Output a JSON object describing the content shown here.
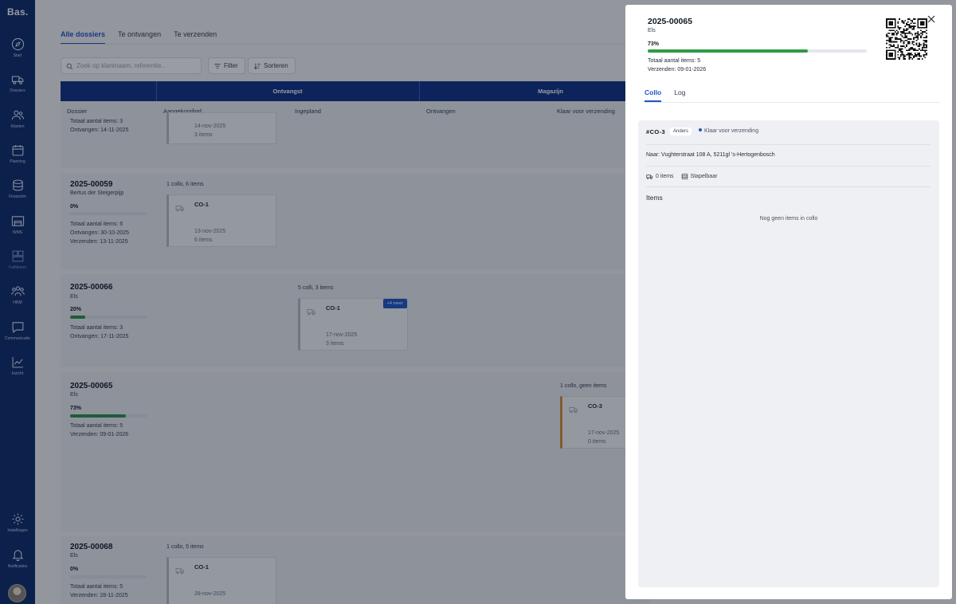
{
  "app": {
    "logo": "Bas."
  },
  "sidebar": {
    "items": [
      {
        "label": "Start",
        "icon": "compass-icon"
      },
      {
        "label": "Dossiers",
        "icon": "truck-icon"
      },
      {
        "label": "Klanten",
        "icon": "users-icon"
      },
      {
        "label": "Planning",
        "icon": "calendar-icon"
      },
      {
        "label": "Financiën",
        "icon": "coins-icon"
      },
      {
        "label": "WMS",
        "icon": "warehouse-icon"
      },
      {
        "label": "Fulfilment",
        "icon": "boxes-icon"
      },
      {
        "label": "HRM",
        "icon": "team-icon"
      },
      {
        "label": "Communicatie",
        "icon": "chat-icon"
      },
      {
        "label": "Inzicht",
        "icon": "chart-icon"
      }
    ],
    "bottom": [
      {
        "label": "Instellingen",
        "icon": "gear-icon"
      },
      {
        "label": "Notificaties",
        "icon": "bell-icon"
      }
    ]
  },
  "main": {
    "tabs": [
      "Alle dossiers",
      "Te ontvangen",
      "Te verzenden"
    ],
    "search_placeholder": "Zoek op klantnaam, referentie...",
    "filter_label": "Filter",
    "sort_label": "Sorteren",
    "groups": [
      "Ontvangst",
      "Magazijn"
    ],
    "columns": [
      "Dossier",
      "Aangekondigd",
      "Ingepland",
      "Ontvangen",
      "Klaar voor verzending"
    ],
    "rows": [
      {
        "partial": true,
        "lines": [
          "Totaal aantal items: 3",
          "Ontvangen: 14-11-2025"
        ],
        "card_date": "14-nov-2025",
        "card_count": "3 items"
      },
      {
        "title": "2025-00059",
        "sub": "Bertus der Steigerpijp",
        "pct": "0%",
        "progress": 0,
        "lines": [
          "Totaal aantal items: 6",
          "Ontvangen: 30-10-2025",
          "Verzenden: 13-11-2025"
        ],
        "lane": "1 collo, 6 items",
        "card": {
          "name": "CO-1",
          "date": "13-nov-2025",
          "count": "6 items"
        }
      },
      {
        "title": "2025-00066",
        "sub": "Els",
        "pct": "20%",
        "progress": 0.2,
        "lines": [
          "Totaal aantal items: 3",
          "Ontvangen: 17-11-2025"
        ],
        "lane": "5 colli, 3 items",
        "card": {
          "name": "CO-1",
          "date": "17-nov-2025",
          "count": "3 items",
          "more": "+4 meer"
        }
      },
      {
        "title": "2025-00065",
        "sub": "Els",
        "pct": "73%",
        "progress": 0.73,
        "lines": [
          "Totaal aantal items: 5",
          "Verzenden: 09-01-2026"
        ],
        "lane": "1 collo, geen items",
        "card": {
          "name": "CO-3",
          "date": "17-nov-2025",
          "count": "0 items"
        }
      },
      {
        "title": "2025-00068",
        "sub": "Els",
        "pct": "0%",
        "progress": 0,
        "lines": [
          "Totaal aantal items: 5",
          "Verzenden: 28-11-2025"
        ],
        "lane": "1 collo, 5 items",
        "card": {
          "name": "CO-1",
          "date": "28-nov-2025"
        }
      }
    ]
  },
  "panel": {
    "title": "2025-00065",
    "sub": "Els",
    "pct": "73%",
    "progress": 0.73,
    "total": "Totaal aantal items: 5",
    "ship": "Verzenden: 09-01-2026",
    "tabs": [
      "Collo",
      "Log"
    ],
    "collo": {
      "id": "#CO-3",
      "badge": "Anders",
      "status": "Klaar voor verzending",
      "address": "Naar: Vughterstraat 108 A, 5211gl 's-Hertogenbosch",
      "items_count": "0 items",
      "stackable": "Stapelbaar",
      "items_heading": "Items",
      "empty": "Nog geen items in collo"
    }
  },
  "colors": {
    "brand": "#0d2a6b",
    "accent": "#1e56c8",
    "progress": "#2f9a45"
  }
}
